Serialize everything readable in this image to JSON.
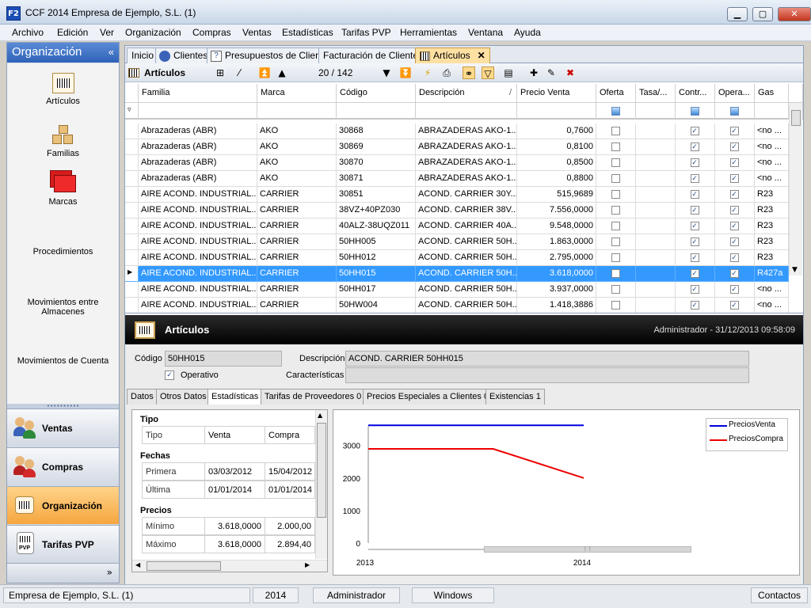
{
  "window": {
    "title": "CCF 2014 Empresa de Ejemplo, S.L. (1)",
    "app_icon": "F2"
  },
  "menu": [
    "Archivo",
    "Edición",
    "Ver",
    "Organización",
    "Compras",
    "Ventas",
    "Estadísticas",
    "Tarifas PVP",
    "Herramientas",
    "Ventana",
    "Ayuda"
  ],
  "left": {
    "header": "Organización",
    "collapse_glyph": "«",
    "items": [
      "Artículos",
      "Familias",
      "Marcas",
      "Procedimientos",
      "Movimientos entre Almacenes",
      "Movimientos de Cuenta"
    ],
    "splitter_glyph": "••••••••••",
    "nav": [
      "Ventas",
      "Compras",
      "Organización",
      "Tarifas PVP"
    ],
    "nav_active": "Organización",
    "footer_glyph": "»"
  },
  "tabs": [
    "Inicio",
    "Clientes",
    "Presupuestos de Cliente",
    "Facturación de Clientes",
    "Artículos"
  ],
  "tab_close": "✕",
  "toolbar": {
    "title": "Artículos",
    "record": "20 / 142"
  },
  "grid": {
    "headers": [
      "Familia",
      "Marca",
      "Código",
      "Descripción",
      "Precio Venta",
      "Oferta",
      "Tasa/...",
      "Contr...",
      "Opera...",
      "Gas"
    ],
    "sort_glyph": "/",
    "rows": [
      [
        "Abrazaderas (ABR)",
        "AKO",
        "30868",
        "ABRAZADERAS AKO-1...",
        "0,7600",
        false,
        "",
        true,
        true,
        "<no ..."
      ],
      [
        "Abrazaderas (ABR)",
        "AKO",
        "30869",
        "ABRAZADERAS AKO-1...",
        "0,8100",
        false,
        "",
        true,
        true,
        "<no ..."
      ],
      [
        "Abrazaderas (ABR)",
        "AKO",
        "30870",
        "ABRAZADERAS AKO-1...",
        "0,8500",
        false,
        "",
        true,
        true,
        "<no ..."
      ],
      [
        "Abrazaderas (ABR)",
        "AKO",
        "30871",
        "ABRAZADERAS AKO-1...",
        "0,8800",
        false,
        "",
        true,
        true,
        "<no ..."
      ],
      [
        "AIRE ACOND. INDUSTRIAL...",
        "CARRIER",
        "30851",
        "ACOND. CARRIER 30Y...",
        "515,9689",
        false,
        "",
        true,
        true,
        "R23"
      ],
      [
        "AIRE ACOND. INDUSTRIAL...",
        "CARRIER",
        "38VZ+40PZ030",
        "ACOND. CARRIER 38V...",
        "7.556,0000",
        false,
        "",
        true,
        true,
        "R23"
      ],
      [
        "AIRE ACOND. INDUSTRIAL...",
        "CARRIER",
        "40ALZ-38UQZ011",
        "ACOND. CARRIER 40A...",
        "9.548,0000",
        false,
        "",
        true,
        true,
        "R23"
      ],
      [
        "AIRE ACOND. INDUSTRIAL...",
        "CARRIER",
        "50HH005",
        "ACOND. CARRIER 50H...",
        "1.863,0000",
        false,
        "",
        true,
        true,
        "R23"
      ],
      [
        "AIRE ACOND. INDUSTRIAL...",
        "CARRIER",
        "50HH012",
        "ACOND. CARRIER 50H...",
        "2.795,0000",
        false,
        "",
        true,
        true,
        "R23"
      ],
      [
        "AIRE ACOND. INDUSTRIAL...",
        "CARRIER",
        "50HH015",
        "ACOND. CARRIER 50H...",
        "3.618,0000",
        false,
        "",
        true,
        true,
        "R427a"
      ],
      [
        "AIRE ACOND. INDUSTRIAL...",
        "CARRIER",
        "50HH017",
        "ACOND. CARRIER 50H...",
        "3.937,0000",
        false,
        "",
        true,
        true,
        "<no ..."
      ],
      [
        "AIRE ACOND. INDUSTRIAL...",
        "CARRIER",
        "50HW004",
        "ACOND. CARRIER 50H...",
        "1.418,3886",
        false,
        "",
        true,
        true,
        "<no ..."
      ]
    ],
    "selected_index": 9,
    "row_pointer": "▶"
  },
  "detail": {
    "title": "Artículos",
    "user_date": "Administrador - 31/12/2013 09:58:09",
    "codigo_label": "Código",
    "codigo": "50HH015",
    "descripcion_label": "Descripción",
    "descripcion": "ACOND. CARRIER 50HH015",
    "operativo_label": "Operativo",
    "caracteristicas_label": "Características",
    "subtabs": [
      "Datos",
      "Otros Datos",
      "Estadísticas",
      "Tarifas de Proveedores 0",
      "Precios Especiales a Clientes 0",
      "Existencias 1"
    ],
    "active_subtab": "Estadísticas"
  },
  "stats": {
    "tipo_header": "Tipo",
    "tipo_row": [
      "Tipo",
      "Venta",
      "Compra"
    ],
    "fechas_header": "Fechas",
    "fechas": [
      [
        "Primera",
        "03/03/2012",
        "15/04/2012"
      ],
      [
        "Última",
        "01/01/2014",
        "01/01/2014"
      ]
    ],
    "precios_header": "Precios",
    "precios": [
      [
        "Mínimo",
        "3.618,0000",
        "2.000,00"
      ],
      [
        "Máximo",
        "3.618,0000",
        "2.894,40"
      ]
    ]
  },
  "chart_data": {
    "type": "line",
    "x": [
      "2013",
      "2014"
    ],
    "ylim": [
      0,
      3600
    ],
    "yticks": [
      0,
      1000,
      2000,
      3000
    ],
    "series": [
      {
        "name": "PreciosVenta",
        "color": "#0000dd",
        "points": [
          [
            0.0,
            3618
          ],
          [
            1.0,
            3618
          ]
        ]
      },
      {
        "name": "PreciosCompra",
        "color": "#ee0000",
        "points": [
          [
            0.0,
            2894
          ],
          [
            0.58,
            2894
          ],
          [
            1.0,
            2000
          ]
        ]
      }
    ],
    "legend": "top-right"
  },
  "status": [
    "Empresa de Ejemplo, S.L. (1)",
    "2014",
    "Administrador",
    "Windows",
    "Contactos"
  ]
}
